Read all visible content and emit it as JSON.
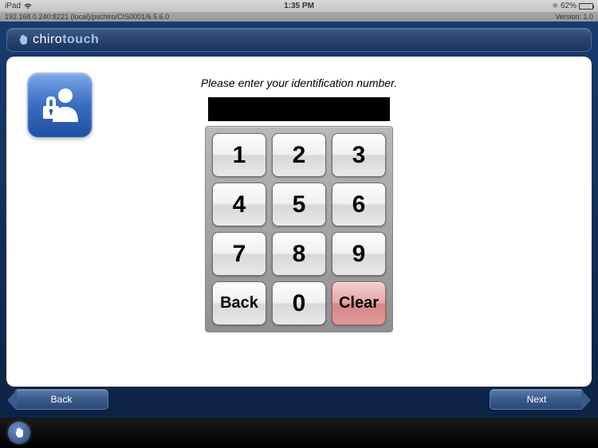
{
  "status_bar": {
    "device": "iPad",
    "time": "1:35 PM",
    "battery_pct": "62%"
  },
  "url_bar": {
    "path": "192.168.0.240:8221 (local)/pschiro/CIS0001/6.5.6.0",
    "version": "Version: 1.0"
  },
  "logo": {
    "part1": "chiro",
    "part2": "touch"
  },
  "main": {
    "prompt": "Please enter your identification number.",
    "input_value": ""
  },
  "keypad": {
    "k1": "1",
    "k2": "2",
    "k3": "3",
    "k4": "4",
    "k5": "5",
    "k6": "6",
    "k7": "7",
    "k8": "8",
    "k9": "9",
    "back": "Back",
    "k0": "0",
    "clear": "Clear"
  },
  "nav": {
    "back": "Back",
    "next": "Next"
  }
}
